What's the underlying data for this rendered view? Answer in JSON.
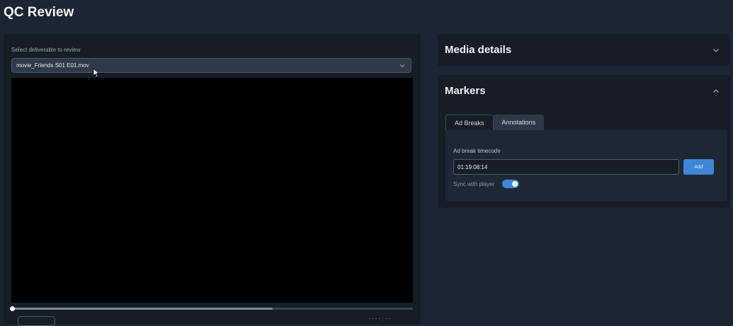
{
  "page": {
    "title": "QC Review"
  },
  "deliverable": {
    "label": "Select deliverable to review",
    "selected": "movie_Friends S01 E01.mov"
  },
  "player": {
    "buffered_fraction": 0.65,
    "played_fraction": 0.0,
    "time_readout": "- - - - : - -"
  },
  "media_details": {
    "title": "Media details",
    "expanded": false
  },
  "markers": {
    "title": "Markers",
    "expanded": true,
    "tabs": [
      {
        "label": "Ad Breaks",
        "active": true
      },
      {
        "label": "Annotations",
        "active": false
      }
    ],
    "ad_break": {
      "field_label": "Ad break timecode",
      "timecode_value": "01:19:08:14",
      "add_label": "Add",
      "sync_label": "Sync with player",
      "sync_enabled": true
    }
  },
  "colors": {
    "background": "#1c2633",
    "panel": "#151d27",
    "accent": "#3f86d9"
  },
  "icons": [
    "chevron-down-icon",
    "chevron-up-icon",
    "cursor-icon"
  ]
}
